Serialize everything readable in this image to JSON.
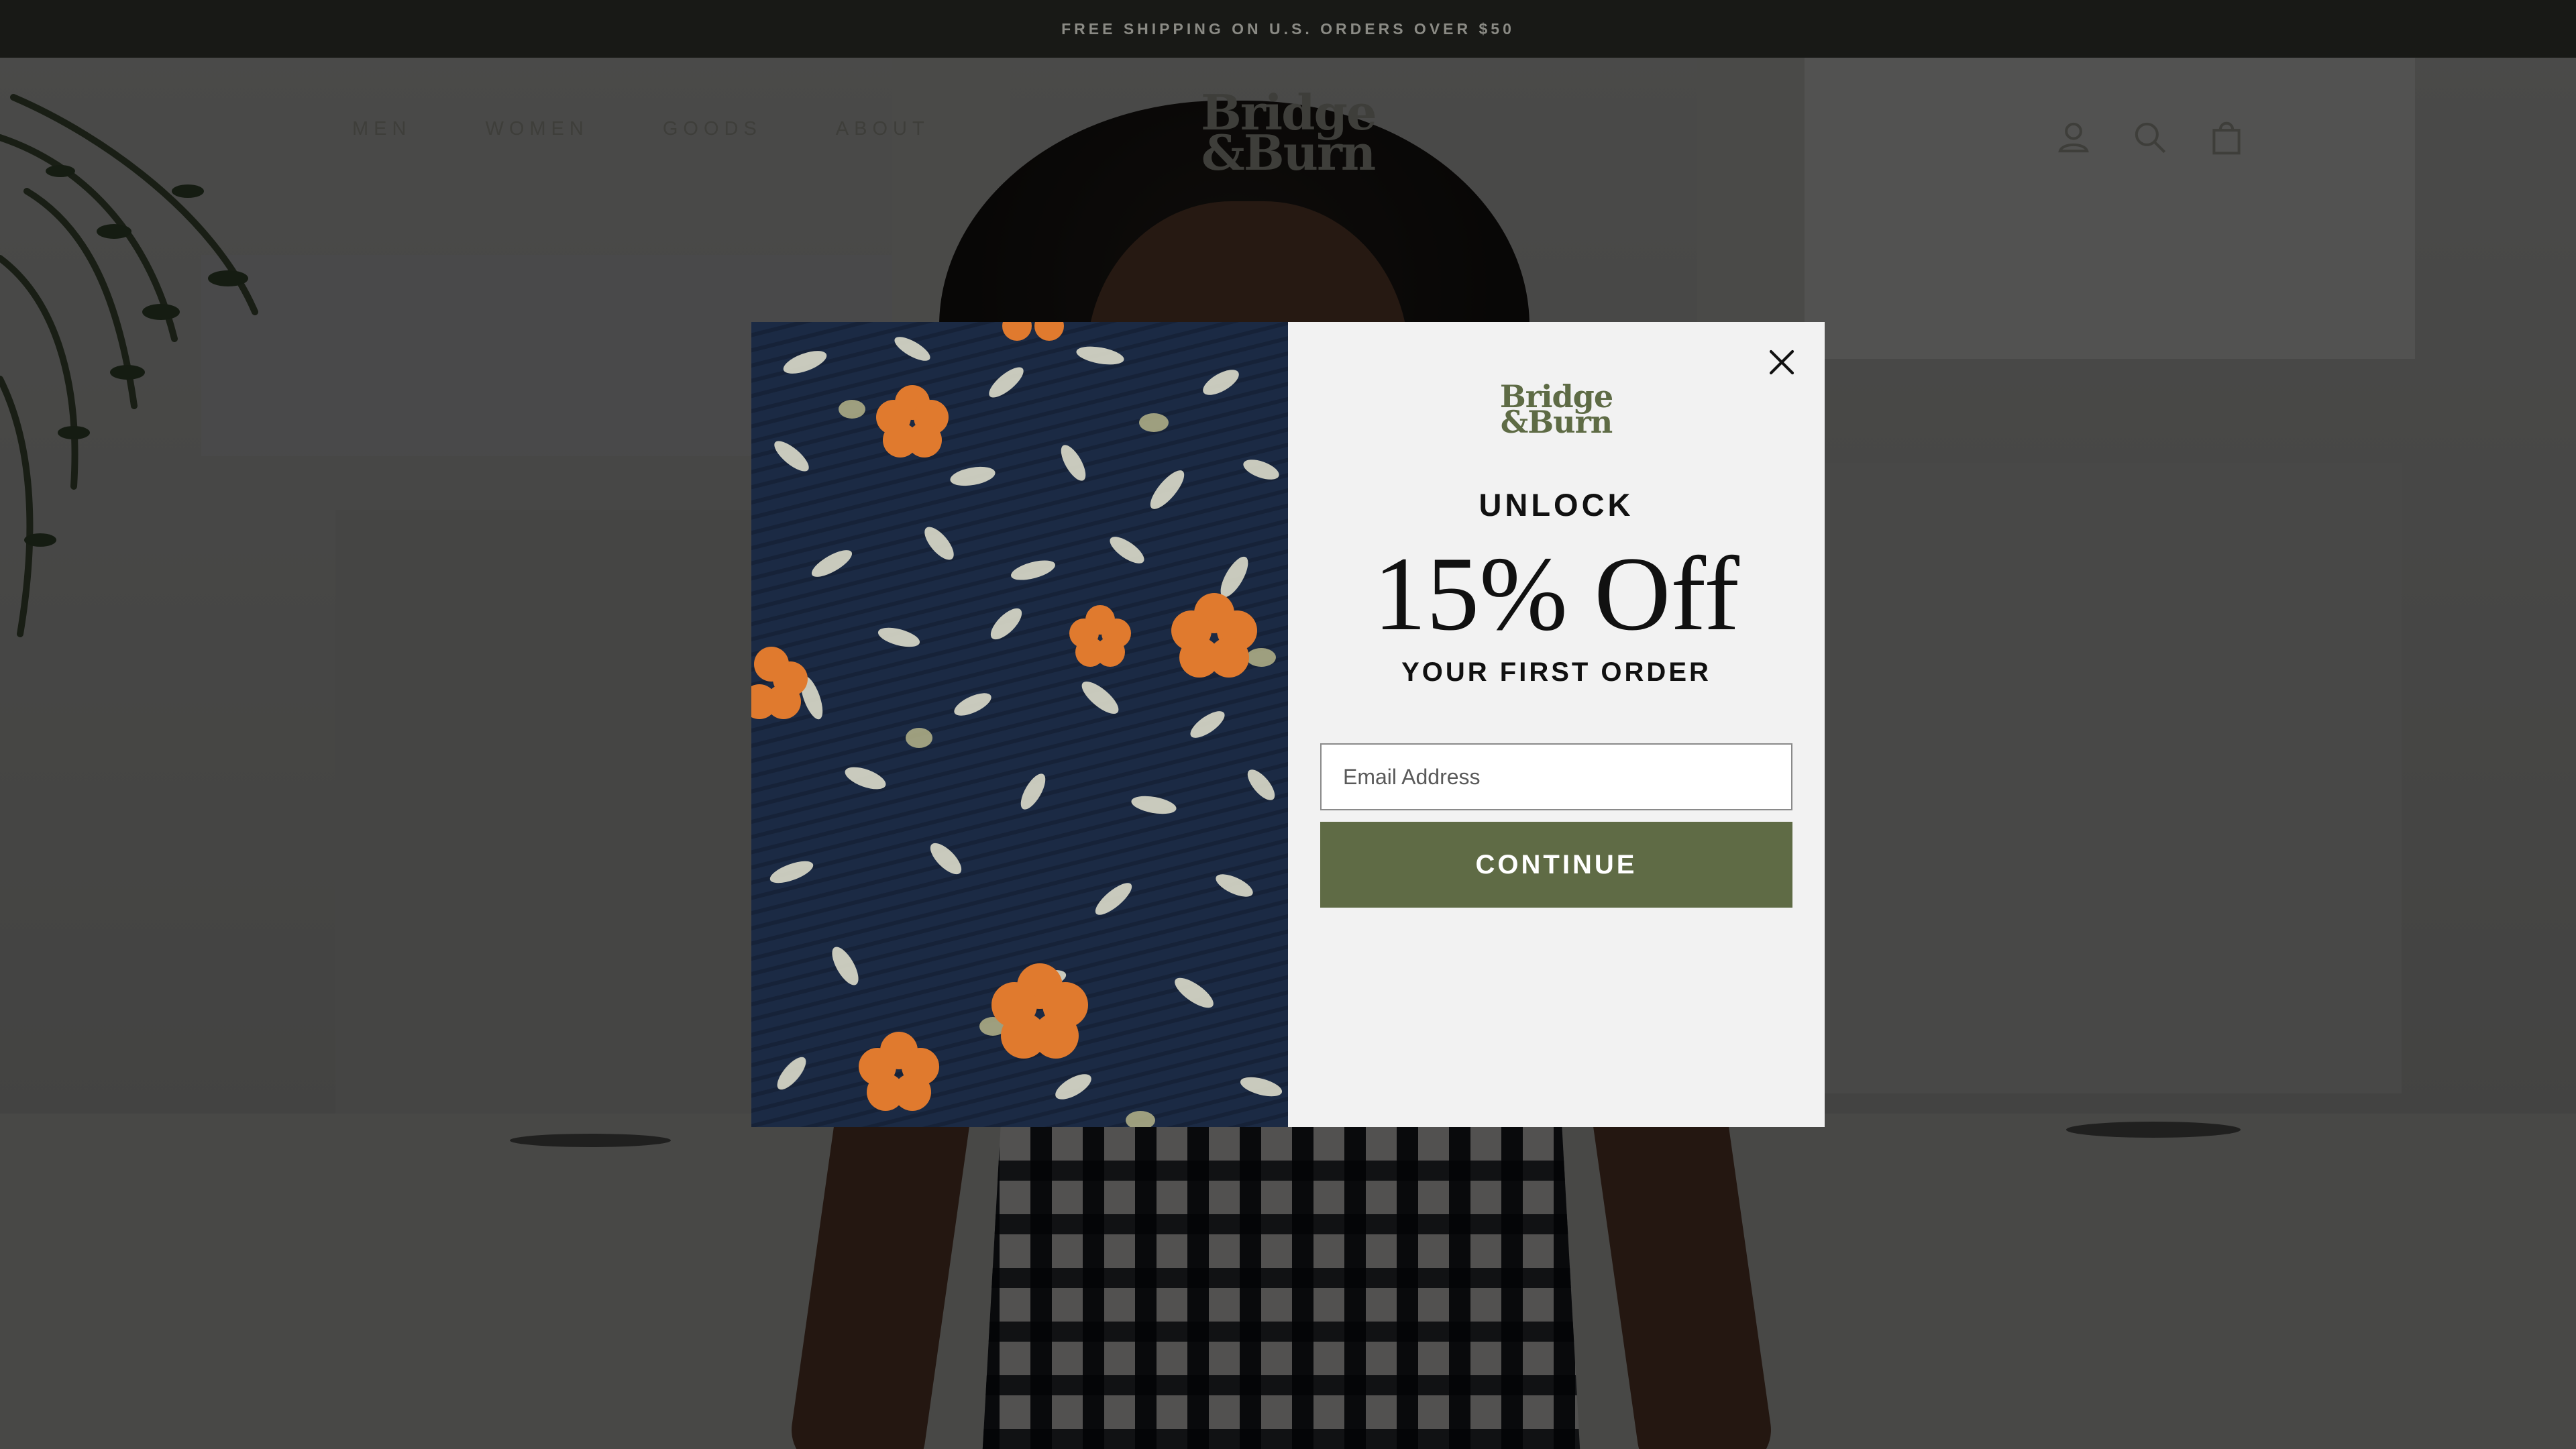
{
  "announcement": {
    "text": "FREE SHIPPING ON U.S. ORDERS OVER $50"
  },
  "header": {
    "nav": [
      {
        "label": "MEN"
      },
      {
        "label": "WOMEN"
      },
      {
        "label": "GOODS"
      },
      {
        "label": "ABOUT"
      }
    ],
    "logo": {
      "line1": "Bridge",
      "line2": "&Burn"
    },
    "icons": [
      "account-icon",
      "search-icon",
      "cart-icon"
    ]
  },
  "popup": {
    "image": "floral-fabric-photo",
    "logo": {
      "line1": "Bridge",
      "line2": "&Burn"
    },
    "headline_top": "UNLOCK",
    "headline_main": "15% Off",
    "headline_bottom": "YOUR FIRST ORDER",
    "email": {
      "placeholder": "Email Address",
      "value": ""
    },
    "cta_label": "CONTINUE",
    "close_icon": "close-icon"
  },
  "colors": {
    "announcement_bg": "#181916",
    "brand_green": "#5f6b45",
    "popup_bg": "#f2f2f2",
    "fabric_navy": "#1b2a44",
    "fabric_orange": "#e07a2e"
  }
}
